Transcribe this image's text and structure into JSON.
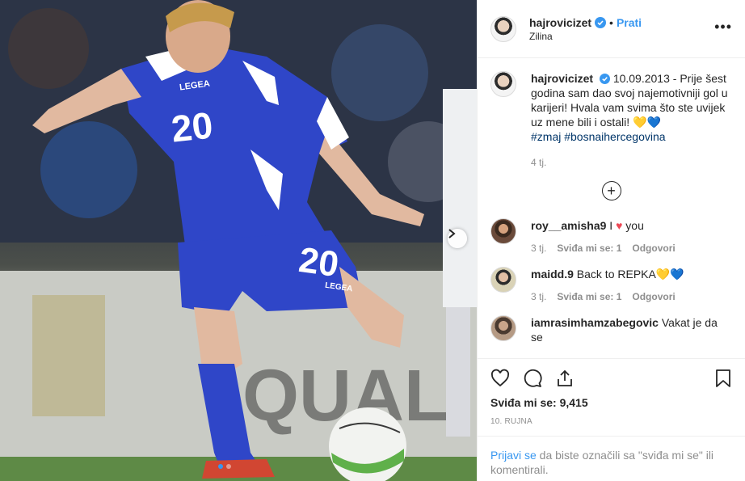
{
  "post": {
    "username": "hajrovicizet",
    "follow_label": "Prati",
    "location": "Zilina",
    "caption_date": "10.09.2013 -",
    "caption_text": "Prije šest godina sam dao svoj najemotivniji gol u karijeri! Hvala vam svima što ste uvijek uz mene bili i ostali! 💛💙",
    "hashtags": "#zmaj #bosnaihercegovina",
    "caption_age": "4 tj.",
    "jersey_number": "20",
    "kit_brand": "LEGEA"
  },
  "comments": [
    {
      "user": "roy__amisha9",
      "text_before": "I",
      "heart": "♥",
      "text_after": "you",
      "age": "3 tj.",
      "likes": "Sviđa mi se: 1",
      "reply": "Odgovori"
    },
    {
      "user": "maidd.9",
      "text": "Back to REPKA💛💙",
      "age": "3 tj.",
      "likes": "Sviđa mi se: 1",
      "reply": "Odgovori"
    },
    {
      "user": "iamrasimhamzabegovic",
      "text": "Vakat je da se"
    }
  ],
  "actions": {
    "likes_text": "Sviđa mi se: 9,415",
    "date": "10. RUJNA"
  },
  "login": {
    "link": "Prijavi se",
    "rest": " da biste označili sa \"sviđa mi se\" ili komentirali."
  },
  "colors": {
    "accent": "#3897f0",
    "jersey": "#2f46c8",
    "hashtag": "#003569"
  },
  "carousel": {
    "dots": 2,
    "active_index": 0
  }
}
